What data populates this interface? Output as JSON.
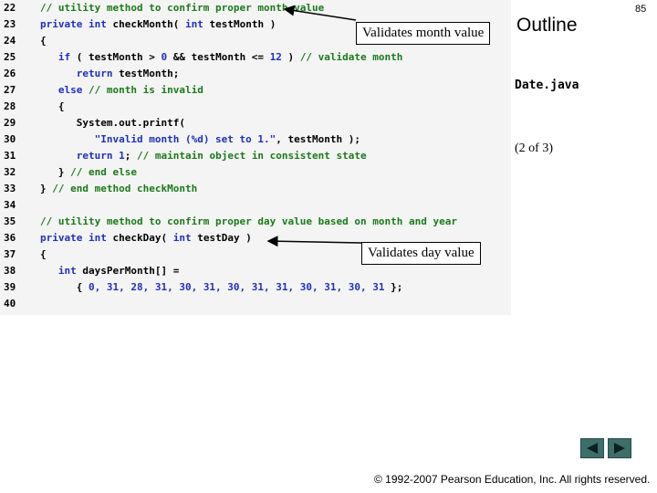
{
  "header": {
    "outline": "Outline",
    "page_number": "85"
  },
  "sidebar": {
    "file_name": "Date.java",
    "page_indicator": "(2 of 3)"
  },
  "callouts": {
    "month": "Validates month value",
    "day": "Validates day value"
  },
  "code_lines": [
    {
      "n": "22",
      "tokens": [
        {
          "t": "// utility method to confirm proper month value",
          "c": "c"
        }
      ]
    },
    {
      "n": "23",
      "tokens": [
        {
          "t": "private int ",
          "c": "k"
        },
        {
          "t": "checkMonth( ",
          "c": "n"
        },
        {
          "t": "int ",
          "c": "k"
        },
        {
          "t": "testMonth )",
          "c": "n"
        }
      ]
    },
    {
      "n": "24",
      "tokens": [
        {
          "t": "{",
          "c": "p"
        }
      ]
    },
    {
      "n": "25",
      "tokens": [
        {
          "t": "   ",
          "c": "p"
        },
        {
          "t": "if ",
          "c": "k"
        },
        {
          "t": "( testMonth > ",
          "c": "n"
        },
        {
          "t": "0",
          "c": "num"
        },
        {
          "t": " && testMonth <= ",
          "c": "n"
        },
        {
          "t": "12",
          "c": "num"
        },
        {
          "t": " ) ",
          "c": "n"
        },
        {
          "t": "// validate month",
          "c": "c"
        }
      ]
    },
    {
      "n": "26",
      "tokens": [
        {
          "t": "      ",
          "c": "p"
        },
        {
          "t": "return ",
          "c": "k"
        },
        {
          "t": "testMonth;",
          "c": "n"
        }
      ]
    },
    {
      "n": "27",
      "tokens": [
        {
          "t": "   ",
          "c": "p"
        },
        {
          "t": "else ",
          "c": "k"
        },
        {
          "t": "// month is invalid",
          "c": "c"
        }
      ]
    },
    {
      "n": "28",
      "tokens": [
        {
          "t": "   {",
          "c": "p"
        }
      ]
    },
    {
      "n": "29",
      "tokens": [
        {
          "t": "      System.out.printf(",
          "c": "n"
        }
      ]
    },
    {
      "n": "30",
      "tokens": [
        {
          "t": "         ",
          "c": "p"
        },
        {
          "t": "\"Invalid month (%d) set to 1.\"",
          "c": "s"
        },
        {
          "t": ", testMonth );",
          "c": "n"
        }
      ]
    },
    {
      "n": "31",
      "tokens": [
        {
          "t": "      ",
          "c": "p"
        },
        {
          "t": "return ",
          "c": "k"
        },
        {
          "t": "1",
          "c": "num"
        },
        {
          "t": "; ",
          "c": "n"
        },
        {
          "t": "// maintain object in consistent state",
          "c": "c"
        }
      ]
    },
    {
      "n": "32",
      "tokens": [
        {
          "t": "   } ",
          "c": "p"
        },
        {
          "t": "// end else",
          "c": "c"
        }
      ]
    },
    {
      "n": "33",
      "tokens": [
        {
          "t": "} ",
          "c": "p"
        },
        {
          "t": "// end method checkMonth",
          "c": "c"
        }
      ]
    },
    {
      "n": "34",
      "tokens": []
    },
    {
      "n": "35",
      "tokens": [
        {
          "t": "// utility method to confirm proper day value based on month and year",
          "c": "c"
        }
      ]
    },
    {
      "n": "36",
      "tokens": [
        {
          "t": "private int ",
          "c": "k"
        },
        {
          "t": "checkDay( ",
          "c": "n"
        },
        {
          "t": "int ",
          "c": "k"
        },
        {
          "t": "testDay )",
          "c": "n"
        }
      ]
    },
    {
      "n": "37",
      "tokens": [
        {
          "t": "{",
          "c": "p"
        }
      ]
    },
    {
      "n": "38",
      "tokens": [
        {
          "t": "   ",
          "c": "p"
        },
        {
          "t": "int ",
          "c": "k"
        },
        {
          "t": "daysPerMonth[] =",
          "c": "n"
        }
      ]
    },
    {
      "n": "39",
      "tokens": [
        {
          "t": "      { ",
          "c": "p"
        },
        {
          "t": "0, 31, 28, 31, 30, 31, 30, 31, 31, 30, 31, 30, 31",
          "c": "num"
        },
        {
          "t": " };",
          "c": "n"
        }
      ]
    },
    {
      "n": "40",
      "tokens": []
    }
  ],
  "footer": {
    "copyright": "© 1992-2007 Pearson Education, Inc.  All rights reserved."
  },
  "colors": {
    "comment": "#1a7a1a",
    "keyword": "#1f2fbf",
    "nav_button": "#3c6e6a"
  },
  "icons": {
    "prev": "triangle-left-icon",
    "next": "triangle-right-icon"
  }
}
